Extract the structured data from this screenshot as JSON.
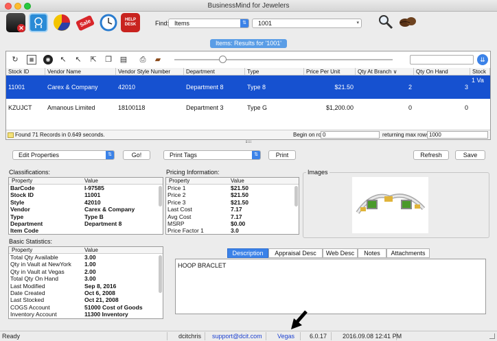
{
  "window": {
    "title": "BusinessMind for Jewelers"
  },
  "toolbar": {
    "find_label": "Find:",
    "find_type": "Items",
    "find_value": "1001",
    "apps": [
      {
        "label": "",
        "color": "#b0262a",
        "icon": "exit-icon"
      },
      {
        "label": "",
        "color": "#2a8bd6",
        "icon": "head-icon"
      },
      {
        "label": "",
        "color": "#f0a000",
        "icon": "chart-icon"
      },
      {
        "label": "Sale",
        "color": "#d8262a",
        "icon": "sale-icon"
      },
      {
        "label": "",
        "color": "#3a8ad6",
        "icon": "clock-icon"
      },
      {
        "label": "HELP DESK",
        "color": "#c8231f",
        "icon": "help-desk-icon"
      }
    ]
  },
  "results": {
    "badge": "Items: Results for '1001'",
    "columns": [
      "Stock ID",
      "Vendor Name",
      "Vendor Style Number",
      "Department",
      "Type",
      "Price Per Unit",
      "Qty At Branch ∨",
      "Qty On Hand",
      "Stock"
    ],
    "rows": [
      {
        "stock_id": "11001",
        "vendor": "Carex & Company",
        "style": "42010",
        "dept": "Department 8",
        "type": "Type 8",
        "price": "$21.50",
        "qty_branch": "2",
        "qty_hand": "3",
        "extra": "1 Va"
      },
      {
        "stock_id": "KZUJCT",
        "vendor": "Amanous Limited",
        "style": "18100118",
        "dept": "Department 3",
        "type": "Type G",
        "price": "$1,200.00",
        "qty_branch": "0",
        "qty_hand": "0",
        "extra": ""
      }
    ],
    "status_found": "Found 71 Records in 0.649 seconds.",
    "begin_label": "Begin on row",
    "begin_value": "0",
    "max_label": "returning max rows of",
    "max_value": "1000"
  },
  "actions": {
    "edit_properties": "Edit Properties",
    "go": "Go!",
    "print_tags": "Print Tags",
    "print": "Print",
    "refresh": "Refresh",
    "save": "Save"
  },
  "classifications": {
    "title": "Classifications:",
    "h_property": "Property",
    "h_value": "Value",
    "items": [
      [
        "BarCode",
        "I-97585"
      ],
      [
        "Stock ID",
        "11001"
      ],
      [
        "Style",
        "42010"
      ],
      [
        "Vendor",
        "Carex & Company"
      ],
      [
        "Type",
        "Type B"
      ],
      [
        "Department",
        "Department 8"
      ],
      [
        "Item Code",
        ""
      ]
    ]
  },
  "pricing": {
    "title": "Pricing Information:",
    "h_property": "Property",
    "h_value": "Value",
    "items": [
      [
        "Price 1",
        "$21.50"
      ],
      [
        "Price 2",
        "$21.50"
      ],
      [
        "Price 3",
        "$21.50"
      ],
      [
        "Last Cost",
        "7.17"
      ],
      [
        "Avg Cost",
        "7.17"
      ],
      [
        "MSRP",
        "$0.00"
      ],
      [
        "Price Factor 1",
        "3.0"
      ]
    ]
  },
  "images": {
    "title": "Images"
  },
  "basic": {
    "title": "Basic Statistics:",
    "h_property": "Property",
    "h_value": "Value",
    "items": [
      [
        "Total Qty Available",
        "3.00"
      ],
      [
        "Qty in Vault at NewYork",
        "1.00"
      ],
      [
        "Qty in Vault at Vegas",
        "2.00"
      ],
      [
        "Total Qty On Hand",
        "3.00"
      ],
      [
        "Last Modified",
        "Sep 8, 2016"
      ],
      [
        "Date Created",
        "Oct 6, 2008"
      ],
      [
        "Last Stocked",
        "Oct 21, 2008"
      ],
      [
        "COGS Account",
        "51000 Cost of Goods"
      ],
      [
        "Inventory Account",
        "11300 Inventory"
      ]
    ]
  },
  "tabs": [
    "Description",
    "Appraisal Desc",
    "Web Desc",
    "Notes",
    "Attachments"
  ],
  "description": "HOOP BRACLET",
  "status": {
    "ready": "Ready",
    "user": "dcitchris",
    "email": "support@dcit.com",
    "location": "Vegas",
    "version": "6.0.17",
    "datetime": "2016.09.08 12:41 PM"
  },
  "colors": {
    "selection": "#1651d0",
    "accent": "#3b82e8",
    "link": "#1a3fd0"
  }
}
